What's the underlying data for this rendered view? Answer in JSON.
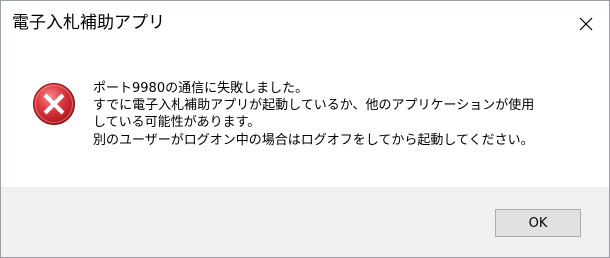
{
  "window": {
    "title": "電子入札補助アプリ",
    "close_icon": "close-icon"
  },
  "message": {
    "icon": "error-icon",
    "lines": [
      "ポート9980の通信に失敗しました。",
      "すでに電子入札補助アプリが起動しているか、他のアプリケーションが使用",
      "している可能性があります。",
      "別のユーザーがログオン中の場合はログオフをしてから起動してください。"
    ]
  },
  "buttons": {
    "ok_label": "OK"
  },
  "colors": {
    "error_red": "#d9333b",
    "footer_bg": "#f0f0f0",
    "button_bg": "#e1e1e1"
  }
}
